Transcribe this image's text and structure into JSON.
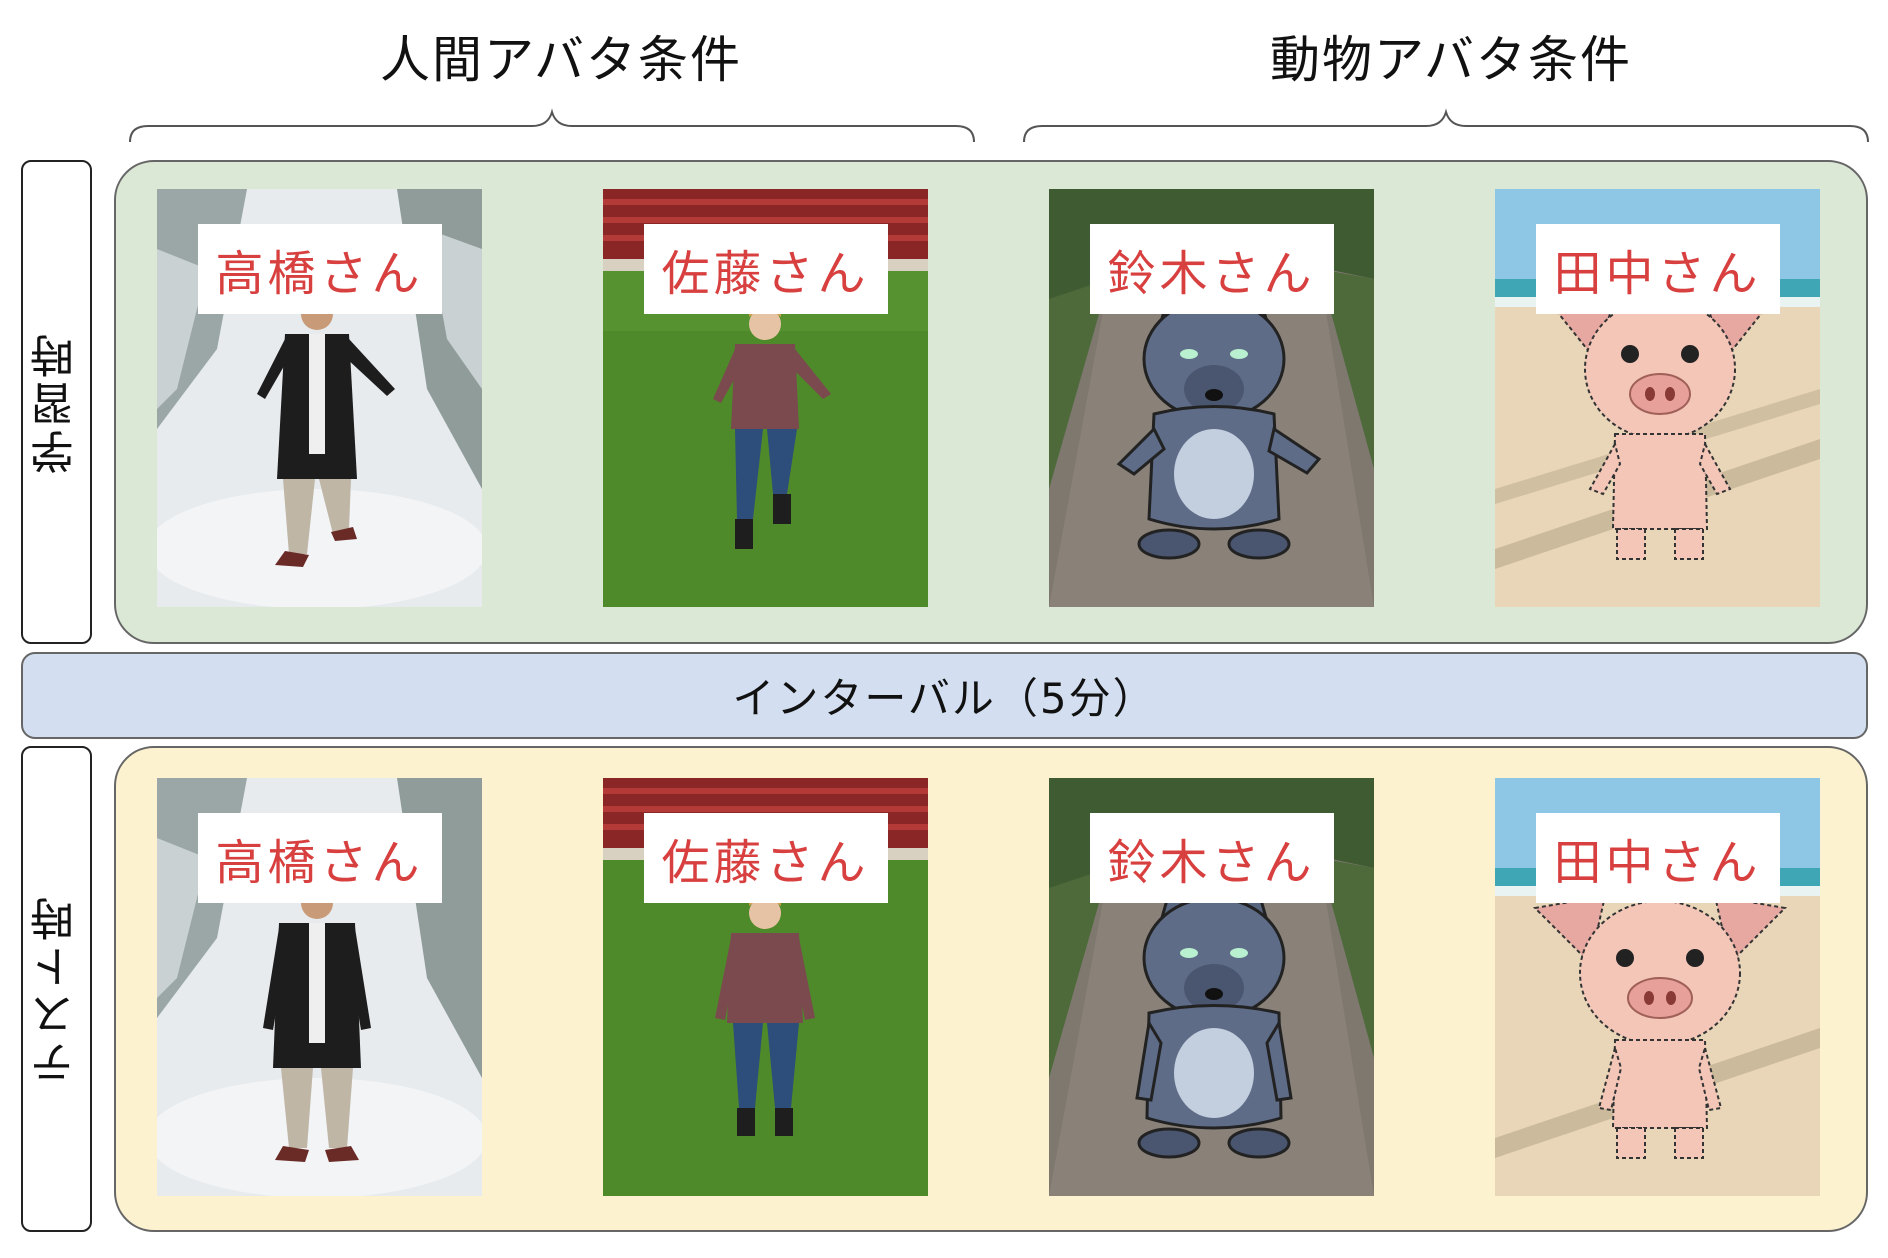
{
  "conditions": {
    "human": "人間アバタ条件",
    "animal": "動物アバタ条件"
  },
  "phases": {
    "learning": "学習時",
    "test": "テスト時"
  },
  "interval": "インターバル（5分）",
  "avatars": [
    {
      "name": "高橋さん",
      "kind": "human",
      "scene": "snowy forest"
    },
    {
      "name": "佐藤さん",
      "kind": "human",
      "scene": "stadium grass"
    },
    {
      "name": "鈴木さん",
      "kind": "wolf",
      "scene": "gravel path"
    },
    {
      "name": "田中さん",
      "kind": "pig",
      "scene": "beach"
    }
  ],
  "colors": {
    "learning_bg": "#dce8d6",
    "test_bg": "#fcf2cf",
    "interval_bg": "#d3dff0",
    "name_text": "#d84040"
  }
}
